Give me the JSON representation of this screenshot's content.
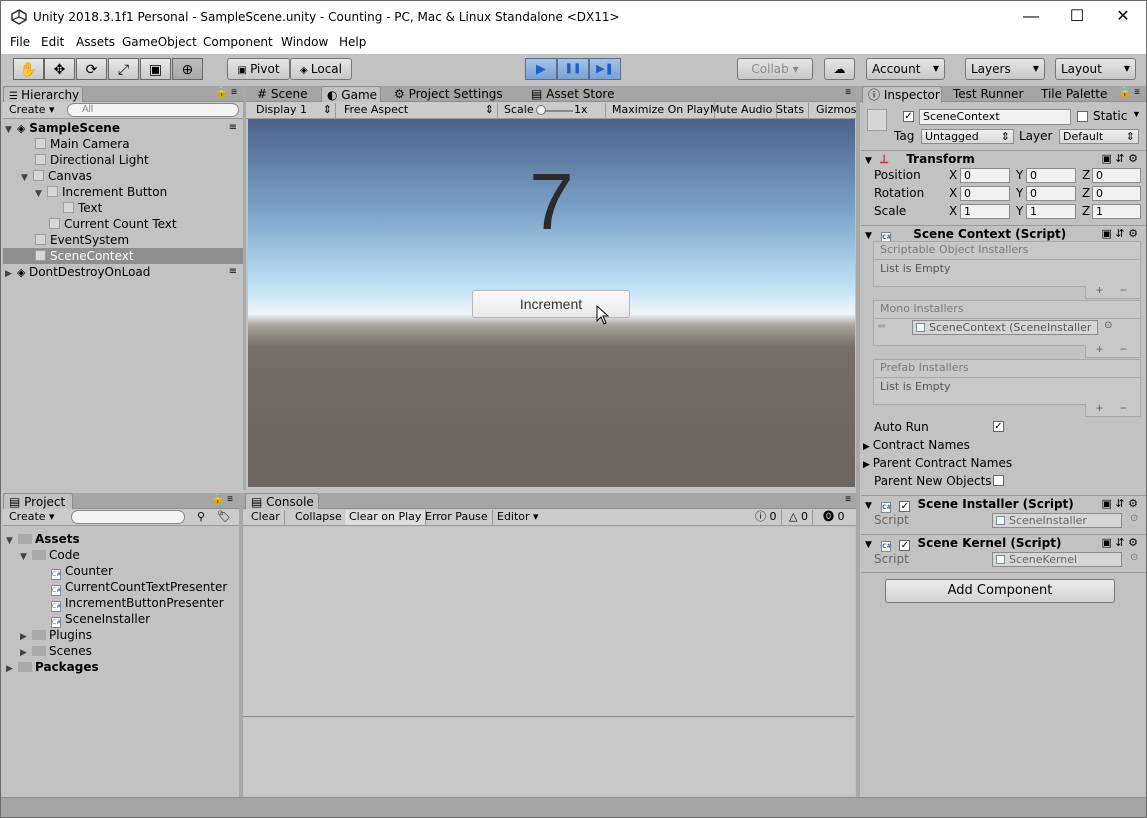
{
  "window": {
    "title": "Unity 2018.3.1f1 Personal - SampleScene.unity - Counting - PC, Mac & Linux Standalone <DX11>",
    "controls": {
      "minimize": "—",
      "maximize": "☐",
      "close": "✕"
    }
  },
  "menu": [
    "File",
    "Edit",
    "Assets",
    "GameObject",
    "Component",
    "Window",
    "Help"
  ],
  "toolbar": {
    "pivot": "Pivot",
    "local": "Local",
    "collab": "Collab",
    "account": "Account",
    "layers": "Layers",
    "layout": "Layout",
    "play_icon": "▶",
    "pause_icon": "❚❚",
    "step_icon": "▶❚"
  },
  "hierarchy": {
    "tab": "Hierarchy",
    "create": "Create",
    "search_placeholder": "All",
    "items": [
      {
        "label": "SampleScene",
        "bold": true
      },
      {
        "label": "Main Camera"
      },
      {
        "label": "Directional Light"
      },
      {
        "label": "Canvas"
      },
      {
        "label": "Increment Button"
      },
      {
        "label": "Text"
      },
      {
        "label": "Current Count Text"
      },
      {
        "label": "EventSystem"
      },
      {
        "label": "SceneContext",
        "selected": true
      },
      {
        "label": "DontDestroyOnLoad"
      }
    ]
  },
  "center_tabs": [
    "Scene",
    "Game",
    "Project Settings",
    "Asset Store"
  ],
  "game_bar": {
    "display": "Display 1",
    "aspect": "Free Aspect",
    "scale_label": "Scale",
    "scale_value": "1x",
    "maximize": "Maximize On Play",
    "mute": "Mute Audio",
    "stats": "Stats",
    "gizmos": "Gizmos"
  },
  "game": {
    "count": "7",
    "button_label": "Increment"
  },
  "inspector": {
    "tabs": [
      "Inspector",
      "Test Runner",
      "Tile Palette"
    ],
    "object_name": "SceneContext",
    "static_label": "Static",
    "tag_label": "Tag",
    "tag_value": "Untagged",
    "layer_label": "Layer",
    "layer_value": "Default",
    "transform": {
      "title": "Transform",
      "rows": [
        {
          "label": "Position",
          "x": "0",
          "y": "0",
          "z": "0"
        },
        {
          "label": "Rotation",
          "x": "0",
          "y": "0",
          "z": "0"
        },
        {
          "label": "Scale",
          "x": "1",
          "y": "1",
          "z": "1"
        }
      ],
      "axis": [
        "X",
        "Y",
        "Z"
      ]
    },
    "scene_context": {
      "title": "Scene Context (Script)",
      "scriptable_header": "Scriptable Object Installers",
      "scriptable_body": "List is Empty",
      "mono_header": "Mono Installers",
      "mono_item": "SceneContext (SceneInstaller",
      "prefab_header": "Prefab Installers",
      "prefab_body": "List is Empty",
      "auto_run": "Auto Run",
      "contract_names": "Contract Names",
      "parent_contract_names": "Parent Contract Names",
      "parent_new_objects": "Parent New Objects"
    },
    "scene_installer": {
      "title": "Scene Installer (Script)",
      "script_label": "Script",
      "script_value": "SceneInstaller"
    },
    "scene_kernel": {
      "title": "Scene Kernel (Script)",
      "script_label": "Script",
      "script_value": "SceneKernel"
    },
    "add_component": "Add Component"
  },
  "project": {
    "tab": "Project",
    "create": "Create",
    "items": [
      {
        "label": "Assets",
        "bold": true
      },
      {
        "label": "Code"
      },
      {
        "label": "Counter"
      },
      {
        "label": "CurrentCountTextPresenter"
      },
      {
        "label": "IncrementButtonPresenter"
      },
      {
        "label": "SceneInstaller"
      },
      {
        "label": "Plugins"
      },
      {
        "label": "Scenes"
      },
      {
        "label": "Packages",
        "bold": true
      }
    ]
  },
  "console": {
    "tab": "Console",
    "clear": "Clear",
    "collapse": "Collapse",
    "clear_on_play": "Clear on Play",
    "error_pause": "Error Pause",
    "editor": "Editor",
    "info_count": "0",
    "warn_count": "0",
    "error_count": "0"
  },
  "colors": {
    "accent": "#3e7ddb",
    "selection": "#8e8e8e",
    "panel": "#c2c2c2"
  }
}
